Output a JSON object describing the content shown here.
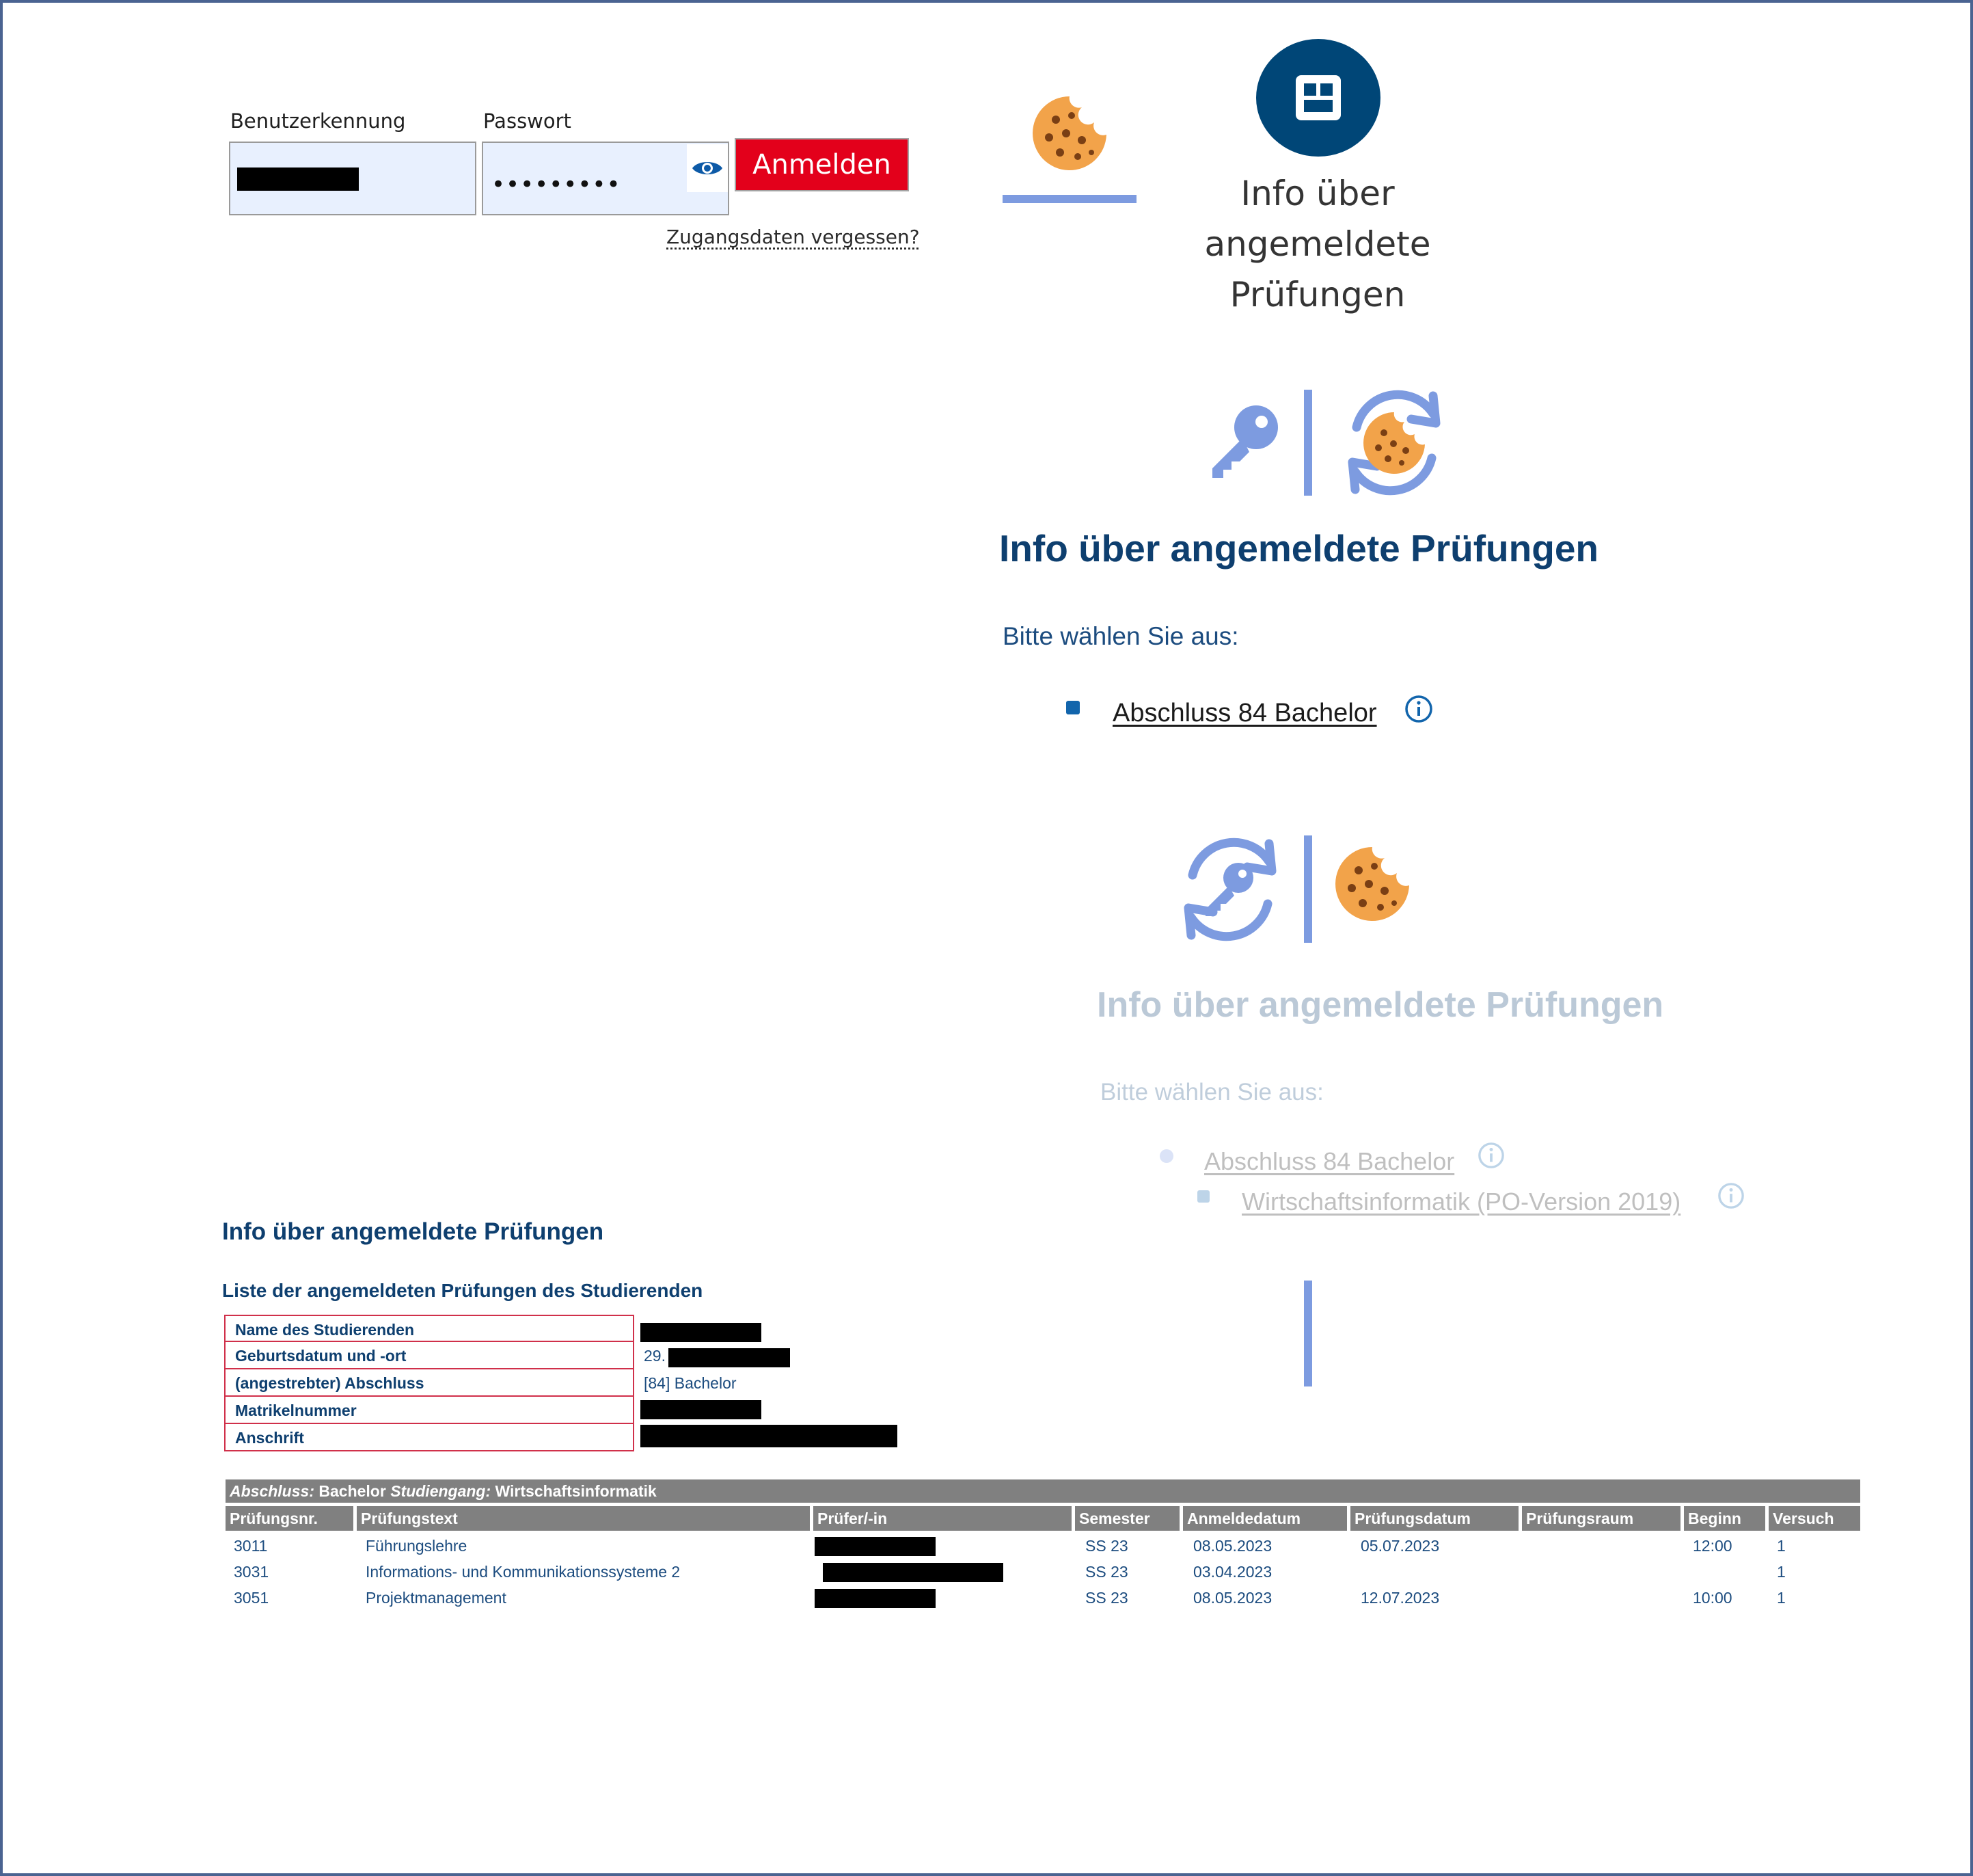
{
  "login": {
    "username_label": "Benutzerkennung",
    "password_label": "Passwort",
    "password_value": "•••••••••",
    "login_button": "Anmelden",
    "forgot_link": "Zugangsdaten vergessen?"
  },
  "tabs": {
    "info_tab_label": [
      "Info über",
      "angemeldete",
      "Prüfungen"
    ]
  },
  "screen1": {
    "title": "Info über angemeldete Prüfungen",
    "prompt": "Bitte wählen Sie aus:",
    "items": [
      {
        "label": "Abschluss 84 Bachelor"
      }
    ]
  },
  "screen2": {
    "title": "Info über angemeldete Prüfungen",
    "prompt": "Bitte wählen Sie aus:",
    "items": [
      {
        "label": "Abschluss 84 Bachelor"
      },
      {
        "label": "Wirtschaftsinformatik (PO-Version 2019) "
      }
    ]
  },
  "list": {
    "title": "Info über angemeldete Prüfungen",
    "subtitle": "Liste der angemeldeten Prüfungen des Studierenden",
    "student_info": [
      {
        "label": "Name des Studierenden",
        "value": ""
      },
      {
        "label": "Geburtsdatum und -ort",
        "value": "29."
      },
      {
        "label": "(angestrebter) Abschluss",
        "value": "[84] Bachelor"
      },
      {
        "label": "Matrikelnummer",
        "value": ""
      },
      {
        "label": "Anschrift",
        "value": ""
      }
    ],
    "caption": {
      "abschluss_label": "Abschluss:",
      "abschluss_value": " Bachelor ",
      "studiengang_label": "Studiengang:",
      "studiengang_value": " Wirtschaftsinformatik"
    },
    "columns": [
      "Prüfungsnr.",
      "Prüfungstext",
      "Prüfer/-in",
      "Semester",
      "Anmeldedatum",
      "Prüfungsdatum",
      "Prüfungsraum",
      "Beginn",
      "Versuch"
    ],
    "rows": [
      {
        "nr": "3011",
        "text": "Führungslehre",
        "semester": "SS 23",
        "anmeldedatum": "08.05.2023",
        "pruefungsdatum": "05.07.2023",
        "raum": "",
        "beginn": "12:00",
        "versuch": "1"
      },
      {
        "nr": "3031",
        "text": "Informations- und Kommunikationssysteme 2",
        "semester": "SS 23",
        "anmeldedatum": "03.04.2023",
        "pruefungsdatum": "",
        "raum": "",
        "beginn": "",
        "versuch": "1"
      },
      {
        "nr": "3051",
        "text": "Projektmanagement",
        "semester": "SS 23",
        "anmeldedatum": "08.05.2023",
        "pruefungsdatum": "12.07.2023",
        "raum": "",
        "beginn": "10:00",
        "versuch": "1"
      }
    ]
  },
  "colors": {
    "heading": "#0e3f6f",
    "login_button": "#e3001b",
    "accent_blue": "#7d9be0",
    "circle_button": "#004677",
    "cookie": "#f2a34a"
  },
  "icons": [
    "eye-icon",
    "cookie-icon",
    "dashboard-icon",
    "key-icon",
    "refresh-icon",
    "info-icon"
  ]
}
